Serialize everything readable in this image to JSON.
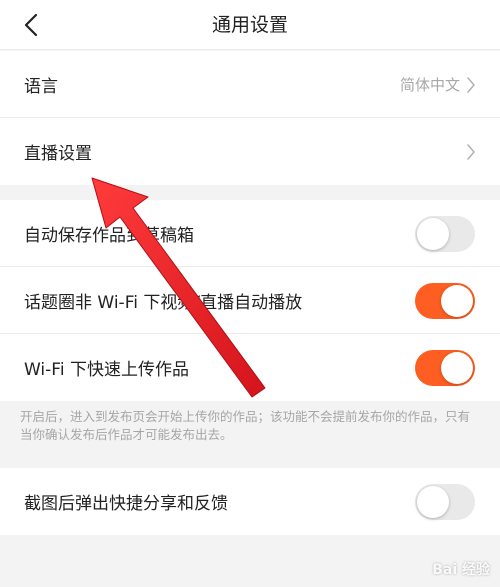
{
  "header": {
    "title": "通用设置",
    "back_icon": "chevron-left-icon"
  },
  "section1": {
    "items": [
      {
        "label": "语言",
        "value": "简体中文"
      },
      {
        "label": "直播设置",
        "value": ""
      }
    ]
  },
  "section2": {
    "items": [
      {
        "label": "自动保存作品到草稿箱",
        "on": false
      },
      {
        "label": "话题圈非 Wi-Fi 下视频/直播自动播放",
        "on": true
      },
      {
        "label": "Wi-Fi 下快速上传作品",
        "on": true
      }
    ],
    "note": "开启后，进入到发布页会开始上传你的作品；该功能不会提前发布你的作品，只有当你确认发布后作品才可能发布出去。"
  },
  "section3": {
    "items": [
      {
        "label": "截图后弹出快捷分享和反馈",
        "on": false
      }
    ]
  },
  "colors": {
    "accent": "#fe5e21",
    "toggle_off": "#e9e9ea",
    "annotation_arrow": "#e8232b"
  },
  "watermark": "Bai 经验"
}
